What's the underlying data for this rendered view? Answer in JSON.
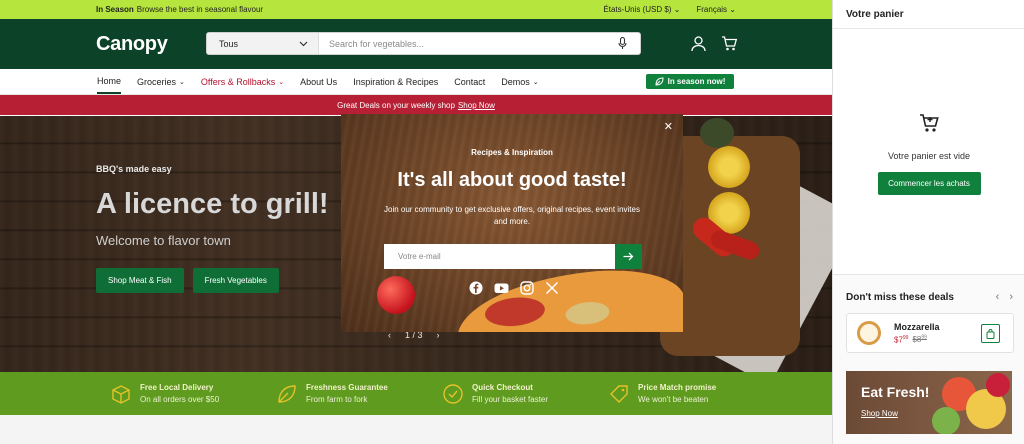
{
  "topbar": {
    "season_label": "In Season",
    "season_text": "Browse the best in seasonal flavour",
    "region": "États-Unis (USD $)",
    "language": "Français"
  },
  "header": {
    "logo": "Canopy",
    "search_category": "Tous",
    "search_placeholder": "Search for vegetables..."
  },
  "nav": {
    "items": [
      {
        "label": "Home",
        "active": true,
        "dropdown": false
      },
      {
        "label": "Groceries",
        "active": false,
        "dropdown": true
      },
      {
        "label": "Offers & Rollbacks",
        "active": false,
        "dropdown": true,
        "highlight": true
      },
      {
        "label": "About Us",
        "active": false,
        "dropdown": false
      },
      {
        "label": "Inspiration & Recipes",
        "active": false,
        "dropdown": false
      },
      {
        "label": "Contact",
        "active": false,
        "dropdown": false
      },
      {
        "label": "Demos",
        "active": false,
        "dropdown": true
      }
    ],
    "cta": "In season now!"
  },
  "promo": {
    "text": "Great Deals on your weekly shop",
    "link": "Shop Now"
  },
  "hero": {
    "kicker": "BBQ's made easy",
    "title": "A licence to grill!",
    "subtitle": "Welcome to flavor town",
    "buttons": [
      "Shop Meat & Fish",
      "Fresh Vegetables"
    ],
    "pager": "1 / 3"
  },
  "features": [
    {
      "icon": "box-icon",
      "title": "Free Local Delivery",
      "text": "On all orders over $50"
    },
    {
      "icon": "leaf-icon",
      "title": "Freshness Guarantee",
      "text": "From farm to fork"
    },
    {
      "icon": "check-circle-icon",
      "title": "Quick Checkout",
      "text": "Fill your basket faster"
    },
    {
      "icon": "tag-icon",
      "title": "Price Match promise",
      "text": "We won't be beaten"
    }
  ],
  "modal": {
    "kicker": "Recipes & Inspiration",
    "title": "It's all about good taste!",
    "description": "Join our community to get exclusive offers, original recipes, event invites and more.",
    "email_placeholder": "Votre e-mail",
    "socials": [
      "facebook-icon",
      "youtube-icon",
      "instagram-icon",
      "x-icon"
    ]
  },
  "cart": {
    "title": "Votre panier",
    "empty_message": "Votre panier est vide",
    "start_button": "Commencer les achats",
    "deals_title": "Don't miss these deals",
    "deal": {
      "name": "Mozzarella",
      "price_dollars": "$7",
      "price_cents": "99",
      "old_dollars": "$8",
      "old_cents": "99"
    },
    "banner": {
      "title": "Eat Fresh!",
      "link": "Shop Now"
    }
  },
  "colors": {
    "brand_dark": "#0c4228",
    "lime": "#b6e53d",
    "green_button": "#10813c",
    "promo_red": "#b71f34",
    "feature_green": "#5e9b1e"
  }
}
